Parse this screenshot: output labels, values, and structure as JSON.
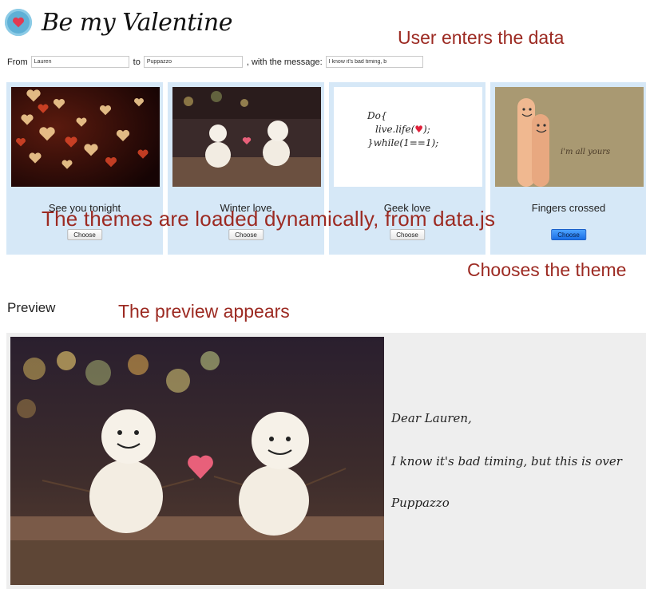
{
  "app": {
    "title": "Be my Valentine",
    "logo_icon": "heart-icon"
  },
  "annotations": {
    "user_enters": "User enters the data",
    "themes_loaded": "The themes are loaded dynamically, from data.js",
    "chooses_theme": "Chooses the theme",
    "preview_appears": "The preview appears"
  },
  "form": {
    "from_label": "From",
    "from_value": "Lauren",
    "to_label": "to",
    "to_value": "Puppazzo",
    "message_label": ", with the message:",
    "message_value": "I know it's bad timing, b"
  },
  "themes": [
    {
      "name": "See you tonight",
      "button": "Choose",
      "selected": false
    },
    {
      "name": "Winter love",
      "button": "Choose",
      "selected": false
    },
    {
      "name": "Geek love",
      "button": "Choose",
      "selected": false
    },
    {
      "name": "Fingers crossed",
      "button": "Choose",
      "selected": true
    }
  ],
  "geek_code": {
    "line1": "Do{",
    "line2": "live.life(",
    "line2_end": ");",
    "line3": "}while(1==1);"
  },
  "fingers_caption": "i'm all yours",
  "preview": {
    "heading": "Preview",
    "greeting": "Dear Lauren,",
    "message": "I know it's bad timing, but this is over",
    "signature": "Puppazzo"
  },
  "colors": {
    "annotation": "#9c2a22",
    "card_bg": "#d6e8f7",
    "accent": "#1a6fe6",
    "preview_bg": "#eeeeee"
  }
}
